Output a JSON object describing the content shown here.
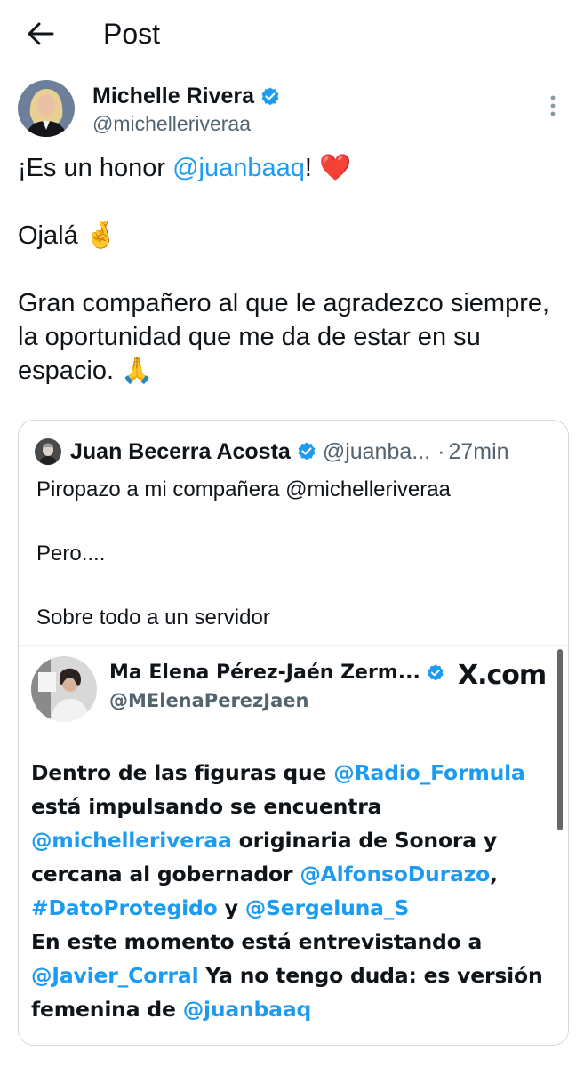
{
  "header": {
    "title": "Post"
  },
  "post": {
    "author_name": "Michelle Rivera",
    "author_handle": "@michelleriveraa",
    "line1_pre": "¡Es un honor ",
    "line1_mention": "@juanbaaq",
    "line1_post": "! ",
    "line1_emoji": "❤️",
    "line2_text": "Ojalá ",
    "line2_emoji": "🤞",
    "line3_text": "Gran compañero al que le agradezco siempre, la oportunidad que me da de estar en su espacio. ",
    "line3_emoji": "🙏"
  },
  "quote": {
    "author_name": "Juan Becerra Acosta",
    "author_handle": "@juanba...",
    "separator": "·",
    "time": "27min",
    "line1": "Piropazo a mi compañera @michelleriveraa",
    "line2": "Pero....",
    "line3": "Sobre todo a un servidor"
  },
  "card": {
    "author_name": "Ma Elena Pérez-Jaén Zerm...",
    "author_handle": "@MElenaPerezJaen",
    "brand": "X.com",
    "t1": "Dentro de las figuras que ",
    "m1": "@Radio_Formula",
    "t2": " está impulsando se encuentra ",
    "m2": "@michelleriveraa",
    "t3": " originaria de Sonora y cercana al gobernador ",
    "m3": "@AlfonsoDurazo",
    "t4": ", ",
    "m4": "#DatoProtegido",
    "t5": " y ",
    "m5": "@Sergeluna_S",
    "t6": "En este momento está entrevistando a ",
    "m6": "@Javier_Corral",
    "t7": " Ya no tengo duda: es versión femenina de ",
    "m7": "@juanbaaq"
  },
  "colors": {
    "link": "#1d9bf0",
    "verified": "#1d9bf0",
    "muted": "#536471"
  }
}
